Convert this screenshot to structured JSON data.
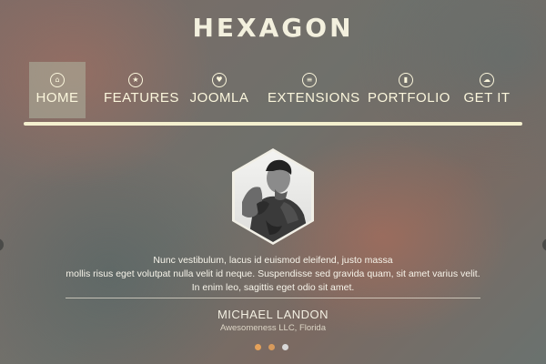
{
  "brand": {
    "logo_text": "HEXAGON"
  },
  "nav": {
    "items": [
      {
        "label": "HOME",
        "icon": "home-icon",
        "glyph": "⌂",
        "active": true
      },
      {
        "label": "FEATURES",
        "icon": "star-icon",
        "glyph": "★",
        "active": false
      },
      {
        "label": "JOOMLA",
        "icon": "heart-icon",
        "glyph": "♥",
        "active": false
      },
      {
        "label": "EXTENSIONS",
        "icon": "list-icon",
        "glyph": "≡",
        "active": false
      },
      {
        "label": "PORTFOLIO",
        "icon": "bookmark-icon",
        "glyph": "▮",
        "active": false
      },
      {
        "label": "GET IT",
        "icon": "download-cloud-icon",
        "glyph": "☁",
        "active": false
      }
    ]
  },
  "testimonial": {
    "quote_lines": [
      "Nunc vestibulum, lacus id euismod eleifend, justo massa",
      "mollis risus eget volutpat nulla velit id neque. Suspendisse sed gravida quam, sit amet varius velit.",
      "In enim leo, sagittis eget odio sit amet."
    ],
    "name": "MICHAEL LANDON",
    "company": "Awesomeness LLC, Florida"
  },
  "slider": {
    "dot_count": 3,
    "active_index": 0,
    "colors": {
      "active": "#e4a15a",
      "inactive_warm": "#d79a5c",
      "inactive": "#d8d8d8"
    }
  },
  "colors": {
    "nav_text": "#fbf6dc",
    "rule": "#f4f0cf"
  }
}
